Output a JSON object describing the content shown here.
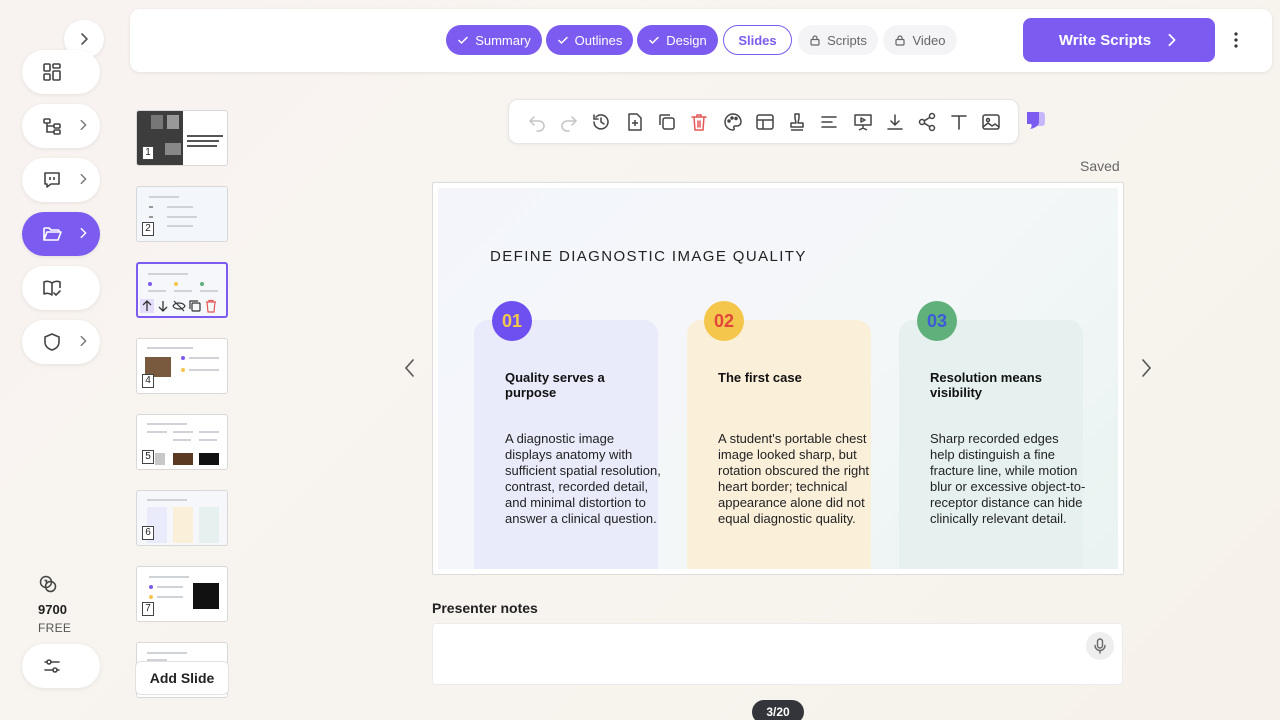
{
  "workflow": {
    "steps": [
      {
        "label": "Summary",
        "state": "done"
      },
      {
        "label": "Outlines",
        "state": "done"
      },
      {
        "label": "Design",
        "state": "done"
      },
      {
        "label": "Slides",
        "state": "current"
      },
      {
        "label": "Scripts",
        "state": "locked"
      },
      {
        "label": "Video",
        "state": "locked"
      }
    ],
    "primary_action": "Write Scripts"
  },
  "sidebar": {
    "items": [
      {
        "icon": "dashboard-icon",
        "has_submenu": false
      },
      {
        "icon": "outline-tree-icon",
        "has_submenu": true
      },
      {
        "icon": "chat-icon",
        "has_submenu": true
      },
      {
        "icon": "folder-open-icon",
        "has_submenu": true,
        "active": true
      },
      {
        "icon": "book-check-icon",
        "has_submenu": false
      },
      {
        "icon": "shield-icon",
        "has_submenu": true
      }
    ],
    "credits": {
      "amount": "9700",
      "plan": "FREE"
    }
  },
  "thumbnails": {
    "numbers": [
      "1",
      "2",
      "3",
      "4",
      "5",
      "6",
      "7"
    ],
    "active_index": 3,
    "add_label": "Add Slide"
  },
  "toolbar": {
    "icons": [
      "undo-icon",
      "redo-icon",
      "history-icon",
      "add-page-icon",
      "duplicate-icon",
      "delete-icon",
      "theme-palette-icon",
      "layout-icon",
      "stamp-icon",
      "align-icon",
      "present-icon",
      "download-icon",
      "share-icon",
      "text-icon",
      "image-icon"
    ]
  },
  "status": {
    "saved": "Saved"
  },
  "slide": {
    "title": "DEFINE DIAGNOSTIC IMAGE QUALITY",
    "cards": [
      {
        "number": "01",
        "heading": "Quality serves a purpose",
        "body": "A diagnostic image displays anatomy with sufficient spatial resolution, contrast, recorded detail, and minimal distortion to answer a clinical question.",
        "badge_color": "#6e4ff0",
        "number_color": "#f2c84b",
        "bg": "#e9ebfb"
      },
      {
        "number": "02",
        "heading": "The first case",
        "body": "A student's portable chest image looked sharp, but rotation obscured the right heart border; technical appearance alone did not equal diagnostic quality.",
        "badge_color": "#f5c64c",
        "number_color": "#e1463d",
        "bg": "#faefd9"
      },
      {
        "number": "03",
        "heading": "Resolution means visibility",
        "body": "Sharp recorded edges help distinguish a fine fracture line, while motion blur or excessive object-to-receptor distance can hide clinically relevant detail.",
        "badge_color": "#5fb07a",
        "number_color": "#3d5bd9",
        "bg": "#e6f1ef"
      }
    ]
  },
  "notes": {
    "label": "Presenter notes",
    "value": ""
  },
  "pagination": {
    "current": "3/20"
  }
}
